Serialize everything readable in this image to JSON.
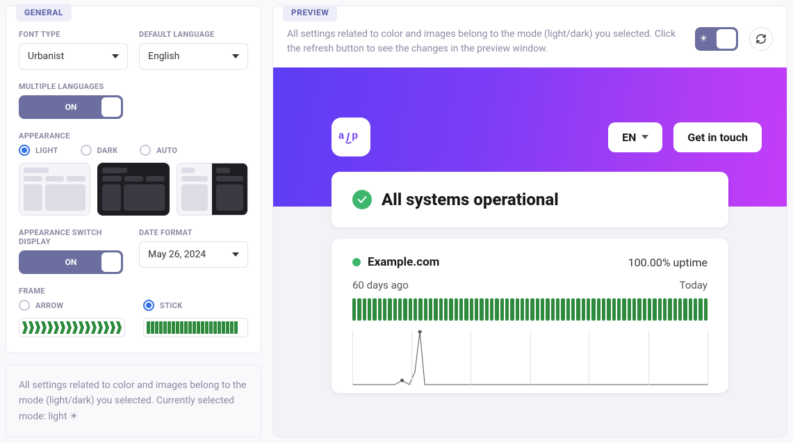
{
  "general": {
    "title": "GENERAL",
    "font_type": {
      "label": "FONT TYPE",
      "value": "Urbanist"
    },
    "default_language": {
      "label": "DEFAULT LANGUAGE",
      "value": "English"
    },
    "multiple_languages": {
      "label": "MULTIPLE LANGUAGES",
      "state": "ON"
    },
    "appearance": {
      "label": "APPEARANCE",
      "options": {
        "light": "LIGHT",
        "dark": "DARK",
        "auto": "AUTO"
      },
      "selected": "light"
    },
    "appearance_switch_display": {
      "label": "APPEARANCE SWITCH DISPLAY",
      "state": "ON"
    },
    "date_format": {
      "label": "DATE FORMAT",
      "value": "May 26, 2024"
    },
    "frame": {
      "label": "FRAME",
      "options": {
        "arrow": "ARROW",
        "stick": "STICK"
      },
      "selected": "stick"
    }
  },
  "mode_note": "All settings related to color and images belong to the mode (light/dark) you selected. Currently selected mode: light ",
  "preview": {
    "title": "PREVIEW",
    "note": "All settings related to color and images belong to the mode (light/dark) you selected. Click the refresh button to see the changes in the preview window.",
    "lang_btn": "EN",
    "contact_btn": "Get in touch",
    "status_headline": "All systems operational",
    "monitor": {
      "name": "Example.com",
      "uptime": "100.00% uptime",
      "range_start": "60 days ago",
      "range_end": "Today"
    },
    "brand": "alp"
  }
}
